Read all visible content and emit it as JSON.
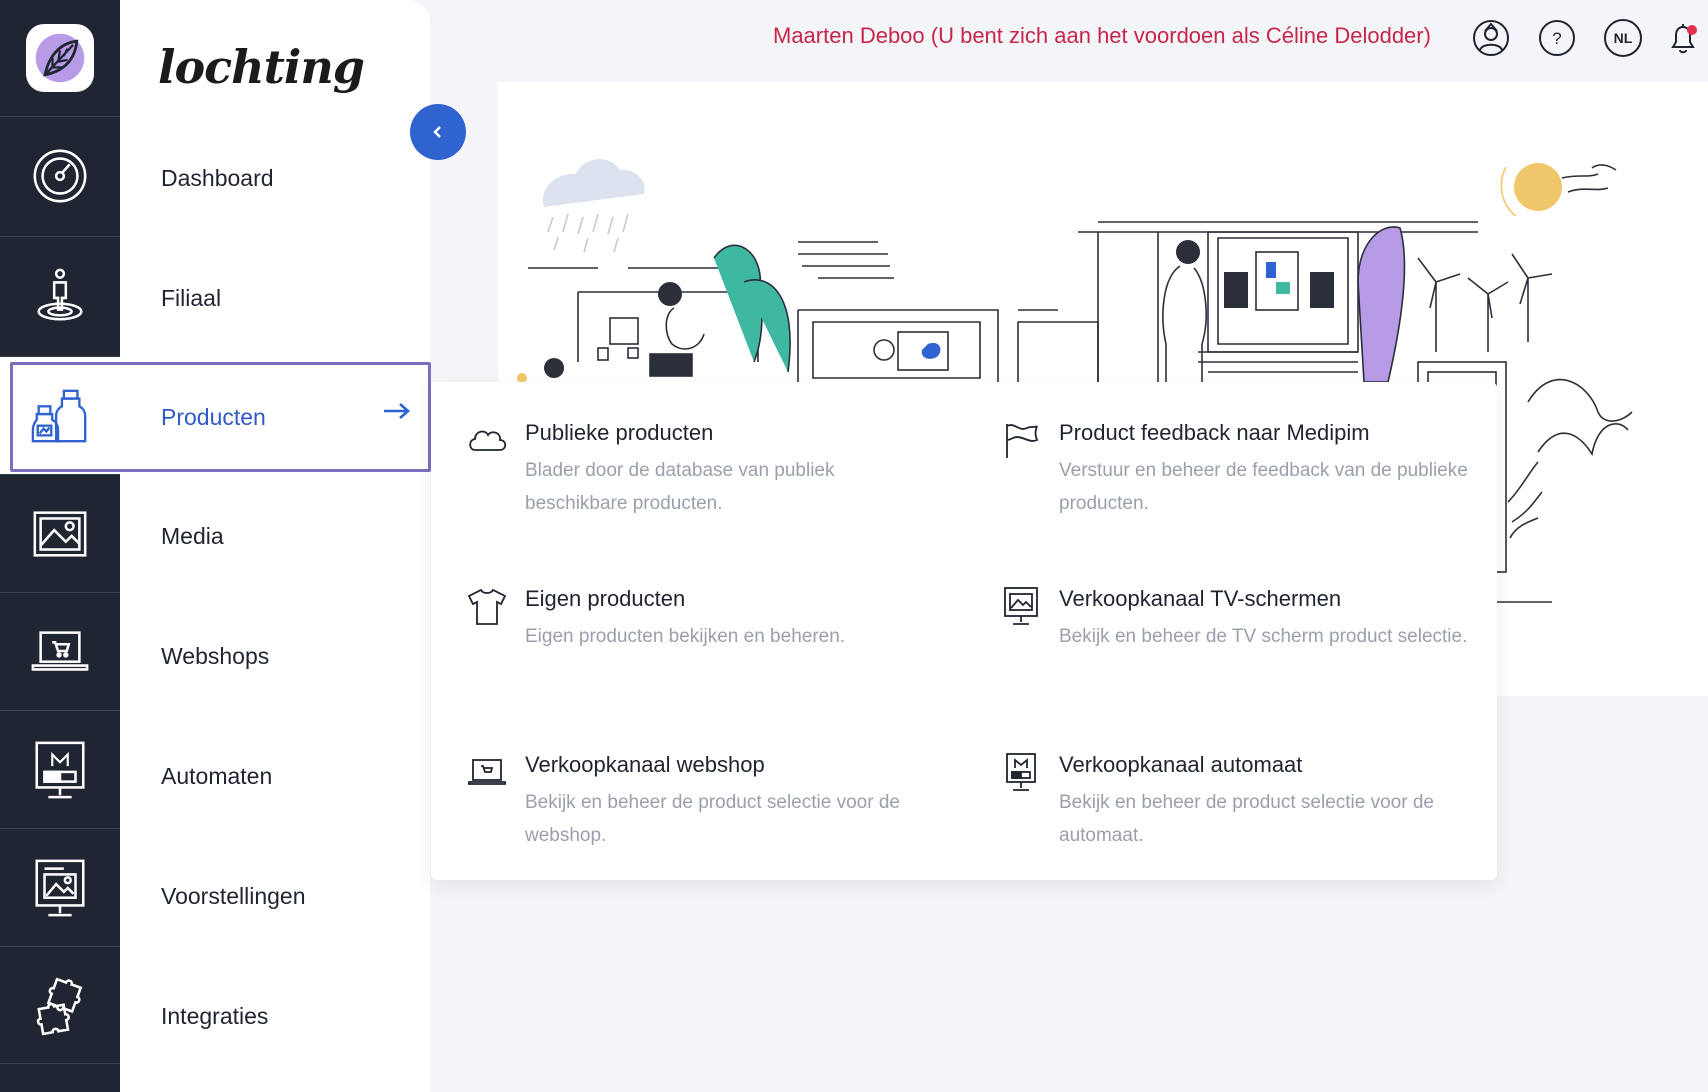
{
  "brand": {
    "name": "lochting"
  },
  "topbar": {
    "impersonation_text": "Maarten Deboo (U bent zich aan het voordoen als Céline Delodder)",
    "language": "NL",
    "icons": [
      "user-switch-icon",
      "help-icon",
      "language-icon",
      "notification-bell-icon"
    ],
    "notification_color": "#e0314f"
  },
  "sidebar": {
    "items": [
      {
        "label": "Dashboard",
        "icon": "speedometer-icon"
      },
      {
        "label": "Filiaal",
        "icon": "location-person-icon"
      },
      {
        "label": "Producten",
        "icon": "medicine-bottles-icon",
        "active": true
      },
      {
        "label": "Media",
        "icon": "image-icon"
      },
      {
        "label": "Webshops",
        "icon": "laptop-cart-icon"
      },
      {
        "label": "Automaten",
        "icon": "vending-machine-icon"
      },
      {
        "label": "Voorstellingen",
        "icon": "presentation-icon"
      },
      {
        "label": "Integraties",
        "icon": "puzzle-icon"
      }
    ]
  },
  "products_menu": {
    "options": [
      {
        "title": "Publieke producten",
        "desc": "Blader door de database van publiek beschikbare producten.",
        "icon": "cloud-icon"
      },
      {
        "title": "Product feedback naar Medipim",
        "desc": "Verstuur en beheer de feedback van de publieke producten.",
        "icon": "flag-icon"
      },
      {
        "title": "Eigen producten",
        "desc": "Eigen producten bekijken en beheren.",
        "icon": "tshirt-icon"
      },
      {
        "title": "Verkoopkanaal TV-schermen",
        "desc": "Bekijk en beheer de TV scherm product selectie.",
        "icon": "tv-screen-icon"
      },
      {
        "title": "Verkoopkanaal webshop",
        "desc": "Bekijk en beheer de product selectie voor de webshop.",
        "icon": "laptop-cart-icon"
      },
      {
        "title": "Verkoopkanaal automaat",
        "desc": "Bekijk en beheer de product selectie voor de automaat.",
        "icon": "vending-machine-icon"
      }
    ]
  },
  "colors": {
    "rail": "#1f2531",
    "accent": "#2f63d0",
    "active_outline": "#7b6fc0",
    "impersonation": "#c7264a",
    "illustration_teal": "#3fb8a2",
    "illustration_purple": "#b79be6",
    "illustration_sun": "#f1c76b"
  }
}
